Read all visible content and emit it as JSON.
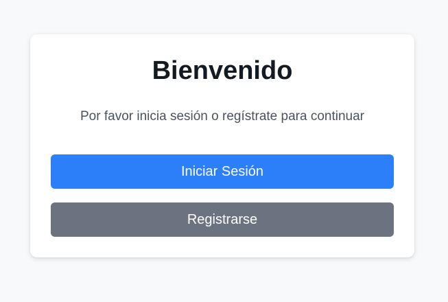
{
  "card": {
    "title": "Bienvenido",
    "subtitle": "Por favor inicia sesión o regístrate para continuar"
  },
  "actions": {
    "login_label": "Iniciar Sesión",
    "register_label": "Registrarse"
  },
  "colors": {
    "page_background": "#f8f9fb",
    "card_background": "#ffffff",
    "title_text": "#141a22",
    "subtitle_text": "#4a5260",
    "primary_button": "#2d7ff9",
    "secondary_button": "#6c7380",
    "button_text": "#ffffff"
  }
}
